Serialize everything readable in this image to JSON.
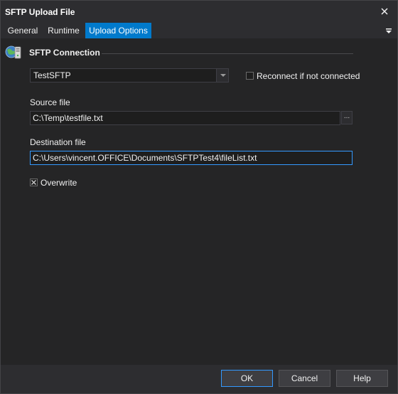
{
  "window": {
    "title": "SFTP Upload File",
    "close_icon": "close-icon"
  },
  "tabs": [
    {
      "label": "General",
      "active": false
    },
    {
      "label": "Runtime",
      "active": false
    },
    {
      "label": "Upload Options",
      "active": true
    }
  ],
  "section": {
    "title": "SFTP Connection",
    "icon": "sftp-globe-server-icon"
  },
  "connection": {
    "selected": "TestSFTP",
    "reconnect_label": "Reconnect if not connected",
    "reconnect_checked": false
  },
  "source": {
    "label": "Source file",
    "value": "C:\\Temp\\testfile.txt",
    "browse_label": "..."
  },
  "destination": {
    "label": "Destination file",
    "value": "C:\\Users\\vincent.OFFICE\\Documents\\SFTPTest4\\fileList.txt"
  },
  "overwrite": {
    "label": "Overwrite",
    "checked": true
  },
  "buttons": {
    "ok": "OK",
    "cancel": "Cancel",
    "help": "Help"
  },
  "colors": {
    "accent": "#007acc",
    "background": "#2d2d30",
    "panel": "#252526",
    "focus": "#3399ff"
  }
}
